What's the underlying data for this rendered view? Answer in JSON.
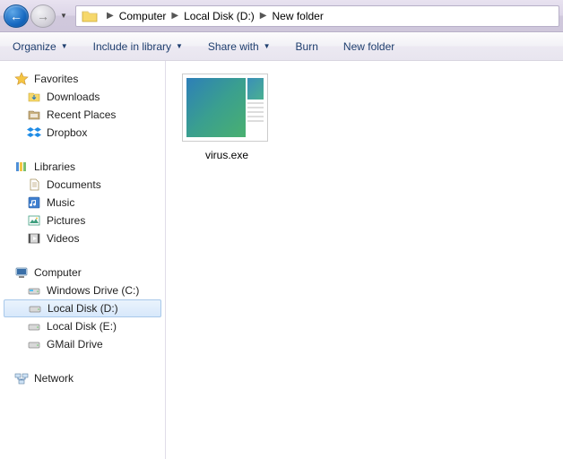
{
  "breadcrumb": {
    "items": [
      "Computer",
      "Local Disk (D:)",
      "New folder"
    ]
  },
  "toolbar": {
    "organize": "Organize",
    "include": "Include in library",
    "share": "Share with",
    "burn": "Burn",
    "newfolder": "New folder"
  },
  "sidebar": {
    "favorites": {
      "label": "Favorites",
      "items": [
        "Downloads",
        "Recent Places",
        "Dropbox"
      ]
    },
    "libraries": {
      "label": "Libraries",
      "items": [
        "Documents",
        "Music",
        "Pictures",
        "Videos"
      ]
    },
    "computer": {
      "label": "Computer",
      "items": [
        "Windows Drive (C:)",
        "Local Disk (D:)",
        "Local Disk (E:)",
        "GMail Drive"
      ],
      "selected_index": 1
    },
    "network": {
      "label": "Network"
    }
  },
  "files": [
    {
      "name": "virus.exe"
    }
  ]
}
